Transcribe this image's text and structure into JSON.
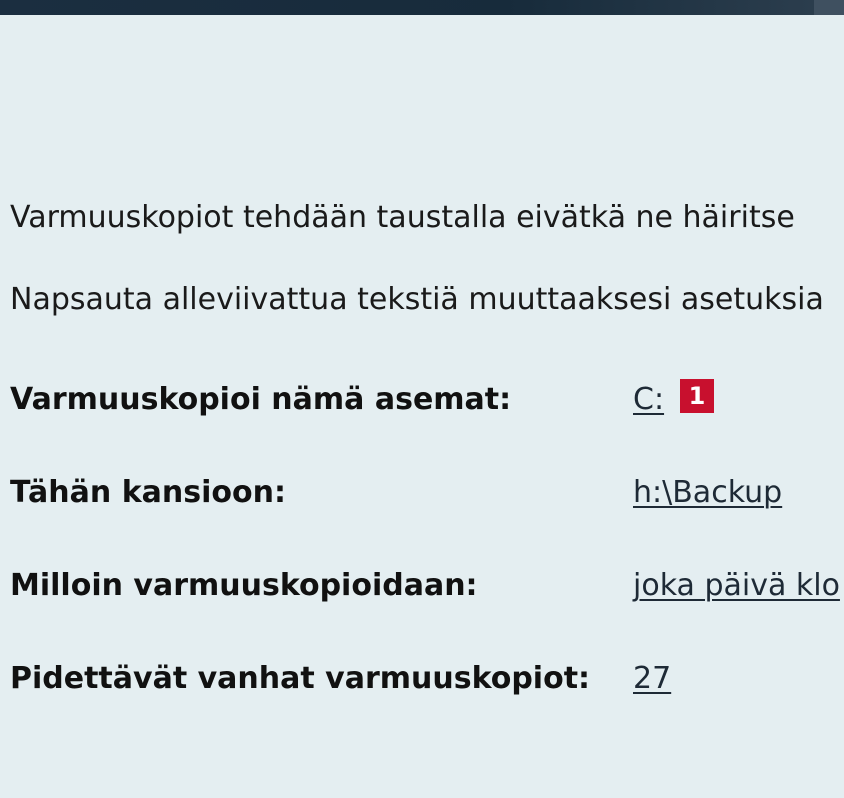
{
  "intro": {
    "line1": "Varmuuskopiot tehdään taustalla eivätkä ne häiritse",
    "line2": "Napsauta alleviivattua tekstiä muuttaaksesi asetuksia"
  },
  "settings": [
    {
      "label": "Varmuuskopioi nämä asemat:",
      "value": "C:"
    },
    {
      "label": "Tähän kansioon:",
      "value": "h:\\Backup"
    },
    {
      "label": "Milloin varmuuskopioidaan:",
      "value": "joka päivä klo"
    },
    {
      "label": "Pidettävät vanhat varmuuskopiot:",
      "value": "27"
    }
  ],
  "annotation": {
    "number": "1",
    "color": "#c8102e"
  }
}
